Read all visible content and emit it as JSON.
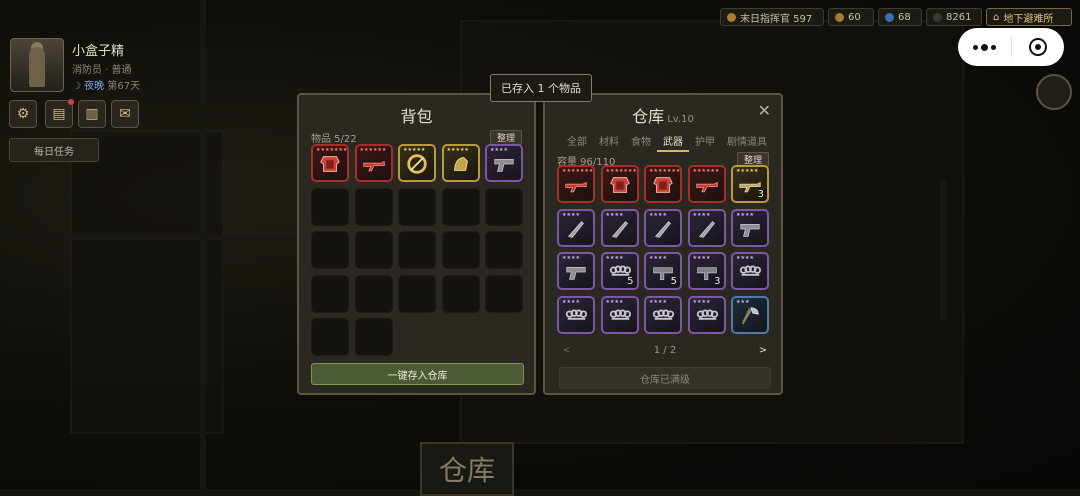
{
  "player": {
    "name": "小盒子精",
    "role": "消防员 · 普通",
    "phase": "夜晚",
    "day": "第67天",
    "daily_task": "每日任务"
  },
  "resources": [
    {
      "icon": "bronze-coin-icon",
      "color": "#b07a3a",
      "label": "末日指挥官 597"
    },
    {
      "icon": "gold-coin-icon",
      "color": "#a37a36",
      "label": "60"
    },
    {
      "icon": "blue-gem-icon",
      "color": "#3b6fb3",
      "label": "68"
    },
    {
      "icon": "dark-coin-icon",
      "color": "#3a3630",
      "label": "8261"
    },
    {
      "icon": "location-icon",
      "color": "#d9b85f",
      "label": "地下避难所"
    }
  ],
  "toast": "已存入 1 个物品",
  "backpack": {
    "title": "背包",
    "count": "物品 5/22",
    "sort": "整理",
    "store_all": "一键存入仓库",
    "slots": [
      {
        "rarity": "red",
        "stars": "★★★★★★★",
        "icon": "red-armor-icon",
        "qty": ""
      },
      {
        "rarity": "red",
        "stars": "★★★★★★",
        "icon": "red-rifle-icon",
        "qty": ""
      },
      {
        "rarity": "gold",
        "stars": "★★★★★",
        "icon": "gold-ring-icon",
        "qty": ""
      },
      {
        "rarity": "gold",
        "stars": "★★★★★",
        "icon": "gold-gauntlet-icon",
        "qty": ""
      },
      {
        "rarity": "purple",
        "stars": "★★★★",
        "icon": "pistol-icon",
        "qty": ""
      }
    ],
    "empty_slots": 17
  },
  "warehouse": {
    "title": "仓库",
    "level": "Lv.10",
    "tabs": [
      "全部",
      "材料",
      "食物",
      "武器",
      "护甲",
      "剧情道具"
    ],
    "active_tab": "武器",
    "capacity": "容量 96/110",
    "sort": "整理",
    "page": "1 / 2",
    "prev": "<",
    "next": ">",
    "full_label": "仓库已满级",
    "slots": [
      {
        "rarity": "red",
        "stars": "★★★★★★★",
        "icon": "red-rifle-icon",
        "qty": ""
      },
      {
        "rarity": "red",
        "stars": "★★★★★★★",
        "icon": "red-armor-icon",
        "qty": ""
      },
      {
        "rarity": "red",
        "stars": "★★★★★★★",
        "icon": "red-armor-icon",
        "qty": ""
      },
      {
        "rarity": "red",
        "stars": "★★★★★★",
        "icon": "red-rifle-icon",
        "qty": ""
      },
      {
        "rarity": "gold",
        "stars": "★★★★★",
        "icon": "gold-rifle-icon",
        "qty": "3"
      },
      {
        "rarity": "purple",
        "stars": "★★★★",
        "icon": "knife-icon",
        "qty": ""
      },
      {
        "rarity": "purple",
        "stars": "★★★★",
        "icon": "knife-icon",
        "qty": ""
      },
      {
        "rarity": "purple",
        "stars": "★★★★",
        "icon": "knife-icon",
        "qty": ""
      },
      {
        "rarity": "purple",
        "stars": "★★★★",
        "icon": "knife-icon",
        "qty": ""
      },
      {
        "rarity": "purple",
        "stars": "★★★★",
        "icon": "pistol-icon",
        "qty": ""
      },
      {
        "rarity": "purple",
        "stars": "★★★★",
        "icon": "pistol-icon",
        "qty": ""
      },
      {
        "rarity": "purple",
        "stars": "★★★★",
        "icon": "knuckles-icon",
        "qty": "5"
      },
      {
        "rarity": "purple",
        "stars": "★★★★",
        "icon": "smg-icon",
        "qty": "5"
      },
      {
        "rarity": "purple",
        "stars": "★★★★",
        "icon": "smg-icon",
        "qty": "3"
      },
      {
        "rarity": "purple",
        "stars": "★★★★",
        "icon": "knuckles-icon",
        "qty": ""
      },
      {
        "rarity": "purple",
        "stars": "★★★★",
        "icon": "knuckles-icon",
        "qty": ""
      },
      {
        "rarity": "purple",
        "stars": "★★★★",
        "icon": "knuckles-icon",
        "qty": ""
      },
      {
        "rarity": "purple",
        "stars": "★★★★",
        "icon": "knuckles-icon",
        "qty": ""
      },
      {
        "rarity": "purple",
        "stars": "★★★★",
        "icon": "knuckles-icon",
        "qty": ""
      },
      {
        "rarity": "blue",
        "stars": "★★★",
        "icon": "axe-icon",
        "qty": ""
      }
    ]
  },
  "floor_label": "仓库"
}
